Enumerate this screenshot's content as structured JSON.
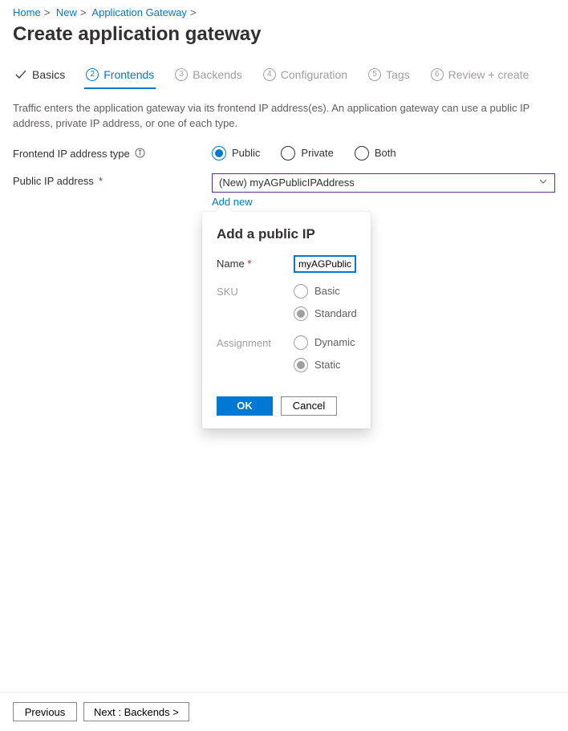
{
  "breadcrumb": {
    "items": [
      "Home",
      "New",
      "Application Gateway"
    ]
  },
  "page_title": "Create application gateway",
  "tabs": [
    {
      "label": "Basics",
      "state": "done"
    },
    {
      "label": "Frontends",
      "num": "2",
      "state": "active"
    },
    {
      "label": "Backends",
      "num": "3",
      "state": "muted"
    },
    {
      "label": "Configuration",
      "num": "4",
      "state": "muted"
    },
    {
      "label": "Tags",
      "num": "5",
      "state": "muted"
    },
    {
      "label": "Review + create",
      "num": "6",
      "state": "muted"
    }
  ],
  "description": "Traffic enters the application gateway via its frontend IP address(es). An application gateway can use a public IP address, private IP address, or one of each type.",
  "frontend_ip": {
    "label": "Frontend IP address type",
    "options": {
      "public": "Public",
      "private": "Private",
      "both": "Both"
    },
    "selected": "public"
  },
  "public_ip": {
    "label": "Public IP address",
    "selected_text": "(New) myAGPublicIPAddress",
    "add_new_label": "Add new"
  },
  "popover": {
    "title": "Add a public IP",
    "name_label": "Name",
    "name_value": "myAGPublicIPAddress",
    "sku_label": "SKU",
    "sku_options": {
      "basic": "Basic",
      "standard": "Standard"
    },
    "assignment_label": "Assignment",
    "assignment_options": {
      "dynamic": "Dynamic",
      "static": "Static"
    },
    "ok_label": "OK",
    "cancel_label": "Cancel"
  },
  "footer": {
    "previous": "Previous",
    "next": "Next : Backends >"
  }
}
